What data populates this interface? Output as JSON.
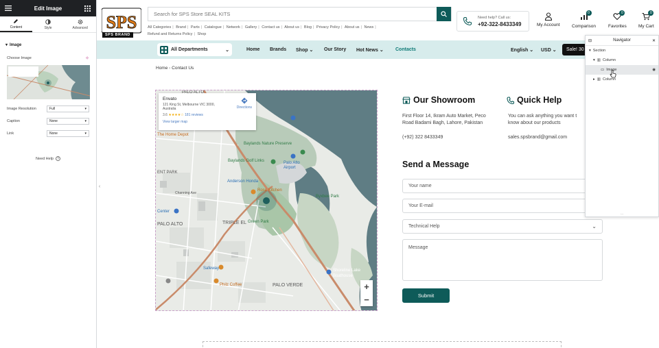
{
  "editor": {
    "title": "Edit Image",
    "tabs": [
      {
        "label": "Content"
      },
      {
        "label": "Style"
      },
      {
        "label": "Advanced"
      }
    ],
    "section_title": "Image",
    "choose_image_label": "Choose Image",
    "resolution": {
      "label": "Image Resolution",
      "value": "Full"
    },
    "caption": {
      "label": "Caption",
      "value": "None"
    },
    "link": {
      "label": "Link",
      "value": "None"
    },
    "need_help": "Need Help"
  },
  "header": {
    "logo_text": "SPS",
    "logo_brand": "SPS BRAND",
    "search_placeholder": "Search for SPS Store SEAL KITS",
    "top_links": [
      "All Categories",
      "Brand",
      "Parts",
      "Catalogue",
      "Network",
      "Gallery",
      "Contact us",
      "About us",
      "Blog",
      "Privacy Policy",
      "About us",
      "News",
      "Refund and Returns Policy",
      "Shop"
    ],
    "help_question": "Need help? Call us:",
    "help_phone": "+92-322-8433349",
    "my_account": "My Account",
    "comparison": {
      "label": "Comparison",
      "count": "0"
    },
    "favorites": {
      "label": "Favorites",
      "count": "0"
    },
    "cart": {
      "label": "My Cart",
      "count": "0"
    }
  },
  "navbar": {
    "departments": "All Departments",
    "links": [
      {
        "label": "Home"
      },
      {
        "label": "Brands"
      },
      {
        "label": "Shop"
      },
      {
        "label": "Our Story"
      },
      {
        "label": "Hot News"
      },
      {
        "label": "Contacts"
      }
    ],
    "language": "English",
    "currency": "USD",
    "sale": "Sale! 30"
  },
  "breadcrumb": {
    "home": "Home",
    "current": "Contact Us"
  },
  "map": {
    "place_name": "Envato",
    "address": "121 King St, Melbourne VIC 3000, Australia",
    "rating": "3.6",
    "reviews": "181 reviews",
    "larger_map": "View larger map",
    "directions": "Directions",
    "labels": {
      "palo_alto_top": "PALO ALTO",
      "home_depot": "The Home Depot",
      "baylands_preserve": "Baylands Nature Preserve",
      "baylands_golf": "Baylands Golf Links",
      "palo_alto_airport": "Palo Alto Airport",
      "ent_park": "ENT PARK",
      "channing": "Channing Ave",
      "anderson_honda": "Anderson Honda",
      "rose_kitchen": "Rose Kitchen",
      "byxbee": "Byxbee Park",
      "center": "Center",
      "palo_alto": "PALO ALTO",
      "triple_el": "TRIPLE EL",
      "green_park": "Green Park",
      "safeway": "Safeway",
      "philz": "Philz Coffee",
      "palo_verde": "PALO VERDE",
      "shoreline": "Shoreline Lake Boathouse"
    }
  },
  "showroom": {
    "title": "Our Showroom",
    "address_line1": "First Floor 14, Ikram Auto Market, Peco",
    "address_line2": "Road Badami Bagh, Lahore, Pakistan",
    "phone": "(+92) 322 8433349"
  },
  "quick_help": {
    "title": "Quick Help",
    "line1": "You can ask anything you want t",
    "line2": "know about our products",
    "email": "sales.spsbrand@gmail.com"
  },
  "form": {
    "title": "Send a Message",
    "name_placeholder": "Your name",
    "email_placeholder": "Your E-mail",
    "topic": "Technical Help",
    "message_placeholder": "Message",
    "submit": "Submit"
  },
  "navigator": {
    "title": "Navigator",
    "rows": [
      {
        "label": "Section"
      },
      {
        "label": "Column"
      },
      {
        "label": "Image"
      },
      {
        "label": "Column"
      }
    ]
  },
  "colors": {
    "accent": "#0e5b59",
    "navbar": "#d7ecec",
    "water": "#5f7d84",
    "land": "#e8eae6"
  }
}
